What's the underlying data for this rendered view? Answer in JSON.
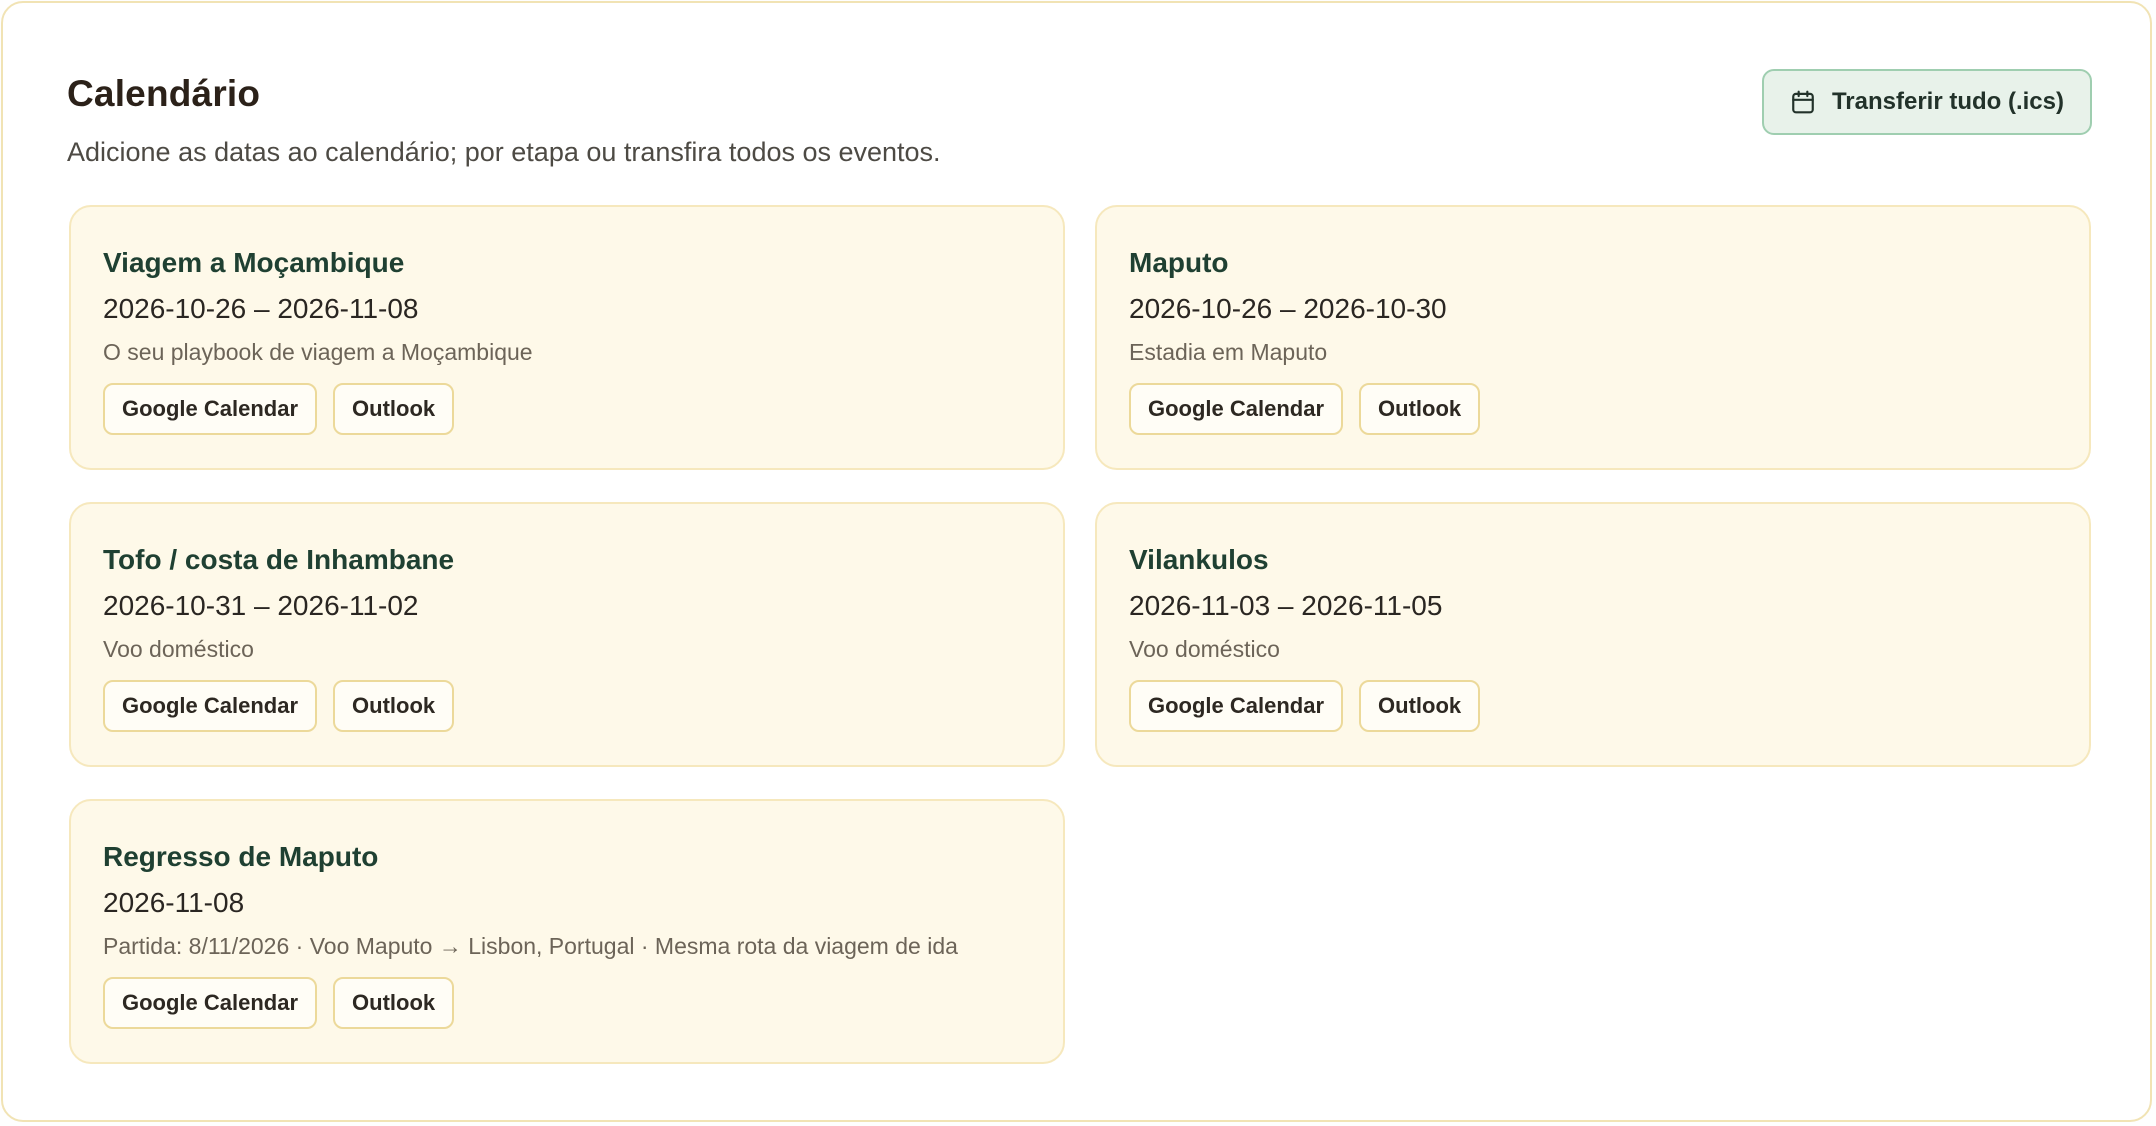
{
  "header": {
    "title": "Calendário",
    "subtitle": "Adicione as datas ao calendário; por etapa ou transfira todos os eventos.",
    "download_all_label": "Transferir tudo (.ics)",
    "download_icon": "calendar-icon"
  },
  "colors": {
    "card_background": "#fef9e9",
    "card_border": "#f6e8bd",
    "card_title": "#1f4032",
    "download_button_background": "#e8f2ea",
    "download_button_border": "#9fceb0",
    "panel_border": "#f1e3b4"
  },
  "events": [
    {
      "title": "Viagem a Moçambique",
      "dates": "2026-10-26 – 2026-11-08",
      "description": "O seu playbook de viagem a Moçambique",
      "google_label": "Google Calendar",
      "outlook_label": "Outlook"
    },
    {
      "title": "Maputo",
      "dates": "2026-10-26 – 2026-10-30",
      "description": "Estadia em Maputo",
      "google_label": "Google Calendar",
      "outlook_label": "Outlook"
    },
    {
      "title": "Tofo / costa de Inhambane",
      "dates": "2026-10-31 – 2026-11-02",
      "description": "Voo doméstico",
      "google_label": "Google Calendar",
      "outlook_label": "Outlook"
    },
    {
      "title": "Vilankulos",
      "dates": "2026-11-03 – 2026-11-05",
      "description": "Voo doméstico",
      "google_label": "Google Calendar",
      "outlook_label": "Outlook"
    },
    {
      "title": "Regresso de Maputo",
      "dates": "2026-11-08",
      "description": "Partida: 8/11/2026 · Voo Maputo → Lisbon, Portugal · Mesma rota da viagem de ida",
      "google_label": "Google Calendar",
      "outlook_label": "Outlook"
    }
  ]
}
